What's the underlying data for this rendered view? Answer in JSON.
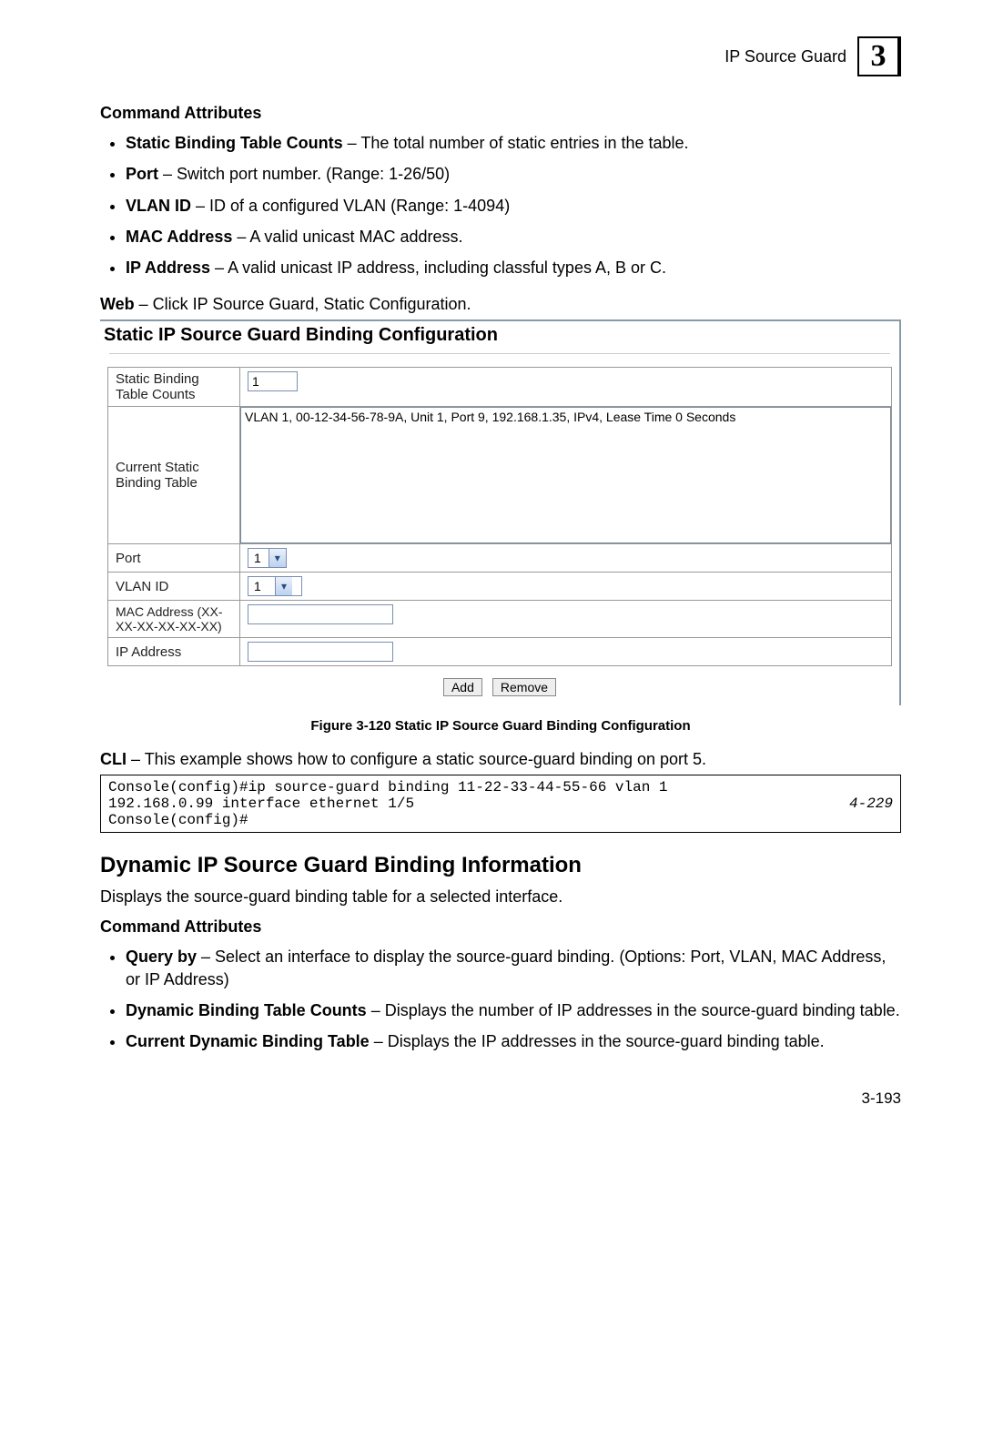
{
  "header": {
    "title": "IP Source Guard",
    "chapter": "3"
  },
  "s1": {
    "heading": "Command Attributes",
    "items": [
      {
        "term": "Static Binding Table Counts",
        "desc": " – The total number of static entries in the table."
      },
      {
        "term": "Port",
        "desc": " – Switch port number. (Range: 1-26/50)"
      },
      {
        "term": "VLAN ID",
        "desc": " – ID of a configured VLAN (Range: 1-4094)"
      },
      {
        "term": "MAC Address",
        "desc": " – A valid unicast MAC address."
      },
      {
        "term": "IP Address",
        "desc": " – A valid unicast IP address, including classful types A, B or C."
      }
    ]
  },
  "web": {
    "label": "Web",
    "text": " – Click IP Source Guard, Static Configuration."
  },
  "panel": {
    "title": "Static IP Source Guard Binding Configuration",
    "rows": {
      "counts_label": "Static Binding Table Counts",
      "counts_value": "1",
      "table_label": "Current Static Binding Table",
      "table_entry": "VLAN 1, 00-12-34-56-78-9A, Unit 1, Port 9, 192.168.1.35, IPv4, Lease Time 0 Seconds",
      "port_label": "Port",
      "port_value": "1",
      "vlan_label": "VLAN ID",
      "vlan_value": "1",
      "mac_label": "MAC Address (XX-XX-XX-XX-XX-XX)",
      "ip_label": "IP Address"
    },
    "buttons": {
      "add": "Add",
      "remove": "Remove"
    }
  },
  "figure": {
    "caption": "Figure 3-120  Static IP Source Guard Binding Configuration"
  },
  "cli": {
    "label": "CLI",
    "text": " – This example shows how to configure a static source-guard binding on port 5.",
    "code_left": "Console(config)#ip source-guard binding 11-22-33-44-55-66 vlan 1\n192.168.0.99 interface ethernet 1/5\nConsole(config)#",
    "code_ref": "4-229"
  },
  "s2": {
    "title": "Dynamic IP Source Guard Binding Information",
    "desc": "Displays the source-guard binding table for a selected interface.",
    "heading": "Command Attributes",
    "items": [
      {
        "term": "Query by",
        "desc": " – Select an interface to display the source-guard binding. (Options: Port, VLAN, MAC Address, or IP Address)"
      },
      {
        "term": "Dynamic Binding Table Counts",
        "desc": " – Displays the number of IP addresses in the source-guard binding table."
      },
      {
        "term": "Current Dynamic Binding Table",
        "desc": " – Displays the IP addresses in the source-guard binding table."
      }
    ]
  },
  "footer": {
    "page": "3-193"
  }
}
